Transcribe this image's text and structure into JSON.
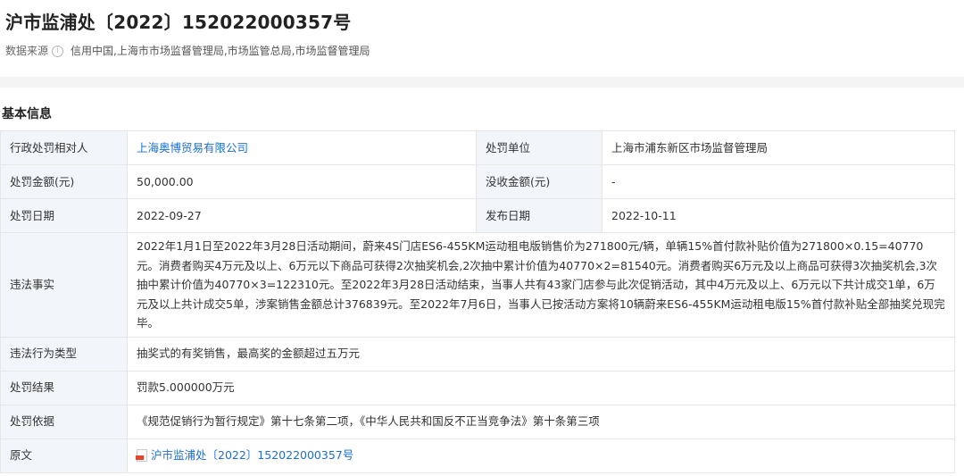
{
  "title": "沪市监浦处〔2022〕152022000357号",
  "source": {
    "label": "数据来源",
    "value": "信用中国,上海市市场监督管理局,市场监管总局,市场监督管理局"
  },
  "section_title": "基本信息",
  "rows": {
    "party": {
      "label": "行政处罚相对人",
      "value": "上海奥博贸易有限公司"
    },
    "unit": {
      "label": "处罚单位",
      "value": "上海市浦东新区市场监督管理局"
    },
    "amount": {
      "label": "处罚金额(元)",
      "value": "50,000.00"
    },
    "confiscation": {
      "label": "没收金额(元)",
      "value": "-"
    },
    "date": {
      "label": "处罚日期",
      "value": "2022-09-27"
    },
    "publish_date": {
      "label": "发布日期",
      "value": "2022-10-11"
    },
    "facts": {
      "label": "违法事实",
      "value": "2022年1月1日至2022年3月28日活动期间，蔚来4S门店ES6-455KM运动租电版销售价为271800元/辆，单辆15%首付款补贴价值为271800×0.15=40770元。消费者购买4万元及以上、6万元以下商品可获得2次抽奖机会,2次抽中累计价值为40770×2=81540元。消费者购买6万元及以上商品可获得3次抽奖机会,3次抽中累计价值为40770×3=122310元。至2022年3月28日活动结束，当事人共有43家门店参与此次促销活动，其中4万元及以上、6万元以下共计成交1单，6万元及以上共计成交5单，涉案销售金额总计376839元。至2022年7月6日，当事人已按活动方案将10辆蔚来ES6-455KM运动租电版15%首付款补贴全部抽奖兑现完毕。"
    },
    "violation_type": {
      "label": "违法行为类型",
      "value": "抽奖式的有奖销售，最高奖的金额超过五万元"
    },
    "result": {
      "label": "处罚结果",
      "value": "罚款5.000000万元"
    },
    "basis": {
      "label": "处罚依据",
      "value": "《规范促销行为暂行规定》第十七条第二项，《中华人民共和国反不正当竞争法》第十条第三项"
    },
    "original": {
      "label": "原文",
      "value": "沪市监浦处〔2022〕152022000357号"
    }
  },
  "icons": [
    "info-icon",
    "pdf-icon"
  ],
  "colors": {
    "link": "#1c6fd0",
    "label_bg": "#f2f6fb",
    "border": "#e6e6e6"
  }
}
